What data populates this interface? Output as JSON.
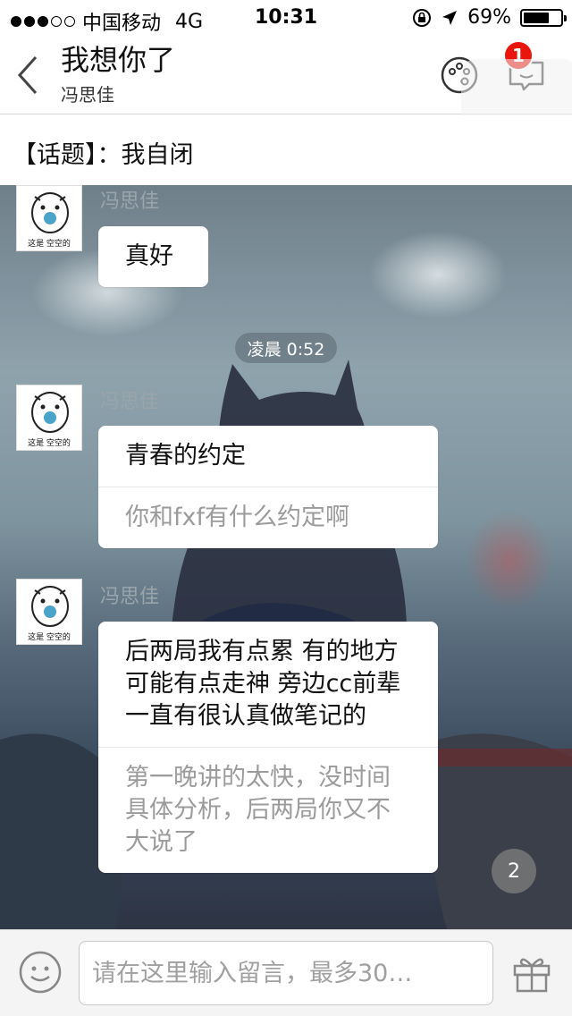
{
  "status_bar": {
    "carrier": "中国移动",
    "network": "4G",
    "time": "10:31",
    "battery": "69%",
    "battery_level": 0.69,
    "signal_bars_filled": 3,
    "signal_bars_total": 5
  },
  "header": {
    "title": "我想你了",
    "subtitle": "冯思佳",
    "notification_count": "1",
    "icons": [
      "back-chevron-icon",
      "palette-icon",
      "message-bubble-icon"
    ]
  },
  "topic": {
    "text": "【话题】：我自闭"
  },
  "avatar_caption": "这是 空空的",
  "messages": [
    {
      "sender": "冯思佳",
      "sections": [
        "真好"
      ]
    },
    {
      "sender": "冯思佳",
      "sections": [
        "青春的约定",
        "你和fxf有什么约定啊"
      ]
    },
    {
      "sender": "冯思佳",
      "sections": [
        "后两局我有点累  有的地方可能有点走神  旁边cc前辈一直有很认真做笔记的",
        "第一晚讲的太快，没时间具体分析，后两局你又不大说了"
      ]
    }
  ],
  "timestamp": "凌晨 0:52",
  "scroll_badge": "2",
  "input_bar": {
    "placeholder": "请在这里输入留言，最多30…",
    "icons": [
      "emoji-icon",
      "gift-icon"
    ]
  },
  "colors": {
    "badge": "#e8160c",
    "bubble": "#ffffff",
    "sender_name": "#9aa4ab"
  }
}
